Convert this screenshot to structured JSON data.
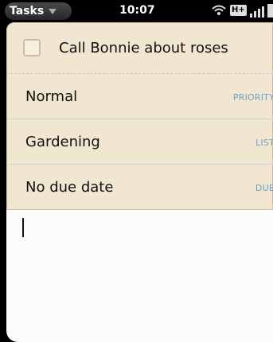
{
  "status_bar": {
    "app_name": "Tasks",
    "time": "10:07",
    "network": "H+"
  },
  "task": {
    "title": "Call Bonnie about roses",
    "completed": false,
    "fields": [
      {
        "value": "Normal",
        "label": "PRIORITY"
      },
      {
        "value": "Gardening",
        "label": "LIST"
      },
      {
        "value": "No due date",
        "label": "DUE"
      }
    ]
  },
  "notes": {
    "text": ""
  },
  "colors": {
    "card_background": "#f1e6cf",
    "field_label": "#6fa1c8",
    "notes_background": "#fbfbfb"
  }
}
